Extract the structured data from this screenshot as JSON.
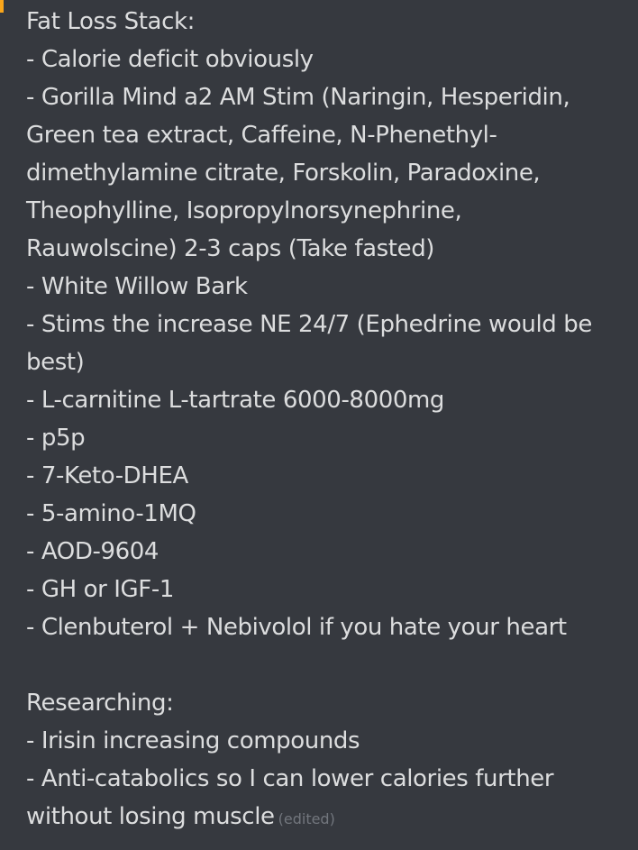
{
  "message": {
    "section1_title": "Fat Loss Stack:",
    "section1_lines": [
      "- Calorie deficit obviously",
      "- Gorilla Mind a2 AM Stim (Naringin, Hesperidin,",
      "Green tea extract, Caffeine, N-Phenethyl-",
      "dimethylamine citrate, Forskolin, Paradoxine,",
      "Theophylline, Isopropylnorsynephrine,",
      "Rauwolscine) 2-3 caps (Take fasted)",
      "- White Willow Bark",
      "- Stims the increase NE 24/7 (Ephedrine would be",
      "best)",
      "- L-carnitine L-tartrate 6000-8000mg",
      "- p5p",
      "- 7-Keto-DHEA",
      "- 5-amino-1MQ",
      "- AOD-9604",
      "- GH or IGF-1",
      "- Clenbuterol + Nebivolol if you hate your heart"
    ],
    "section2_title": "Researching:",
    "section2_lines": [
      "- Irisin increasing compounds",
      "- Anti-catabolics so I can lower calories further",
      "without losing muscle"
    ],
    "edited_label": "(edited)"
  },
  "colors": {
    "background": "#36393f",
    "text": "#dcddde",
    "muted": "#72767d"
  }
}
